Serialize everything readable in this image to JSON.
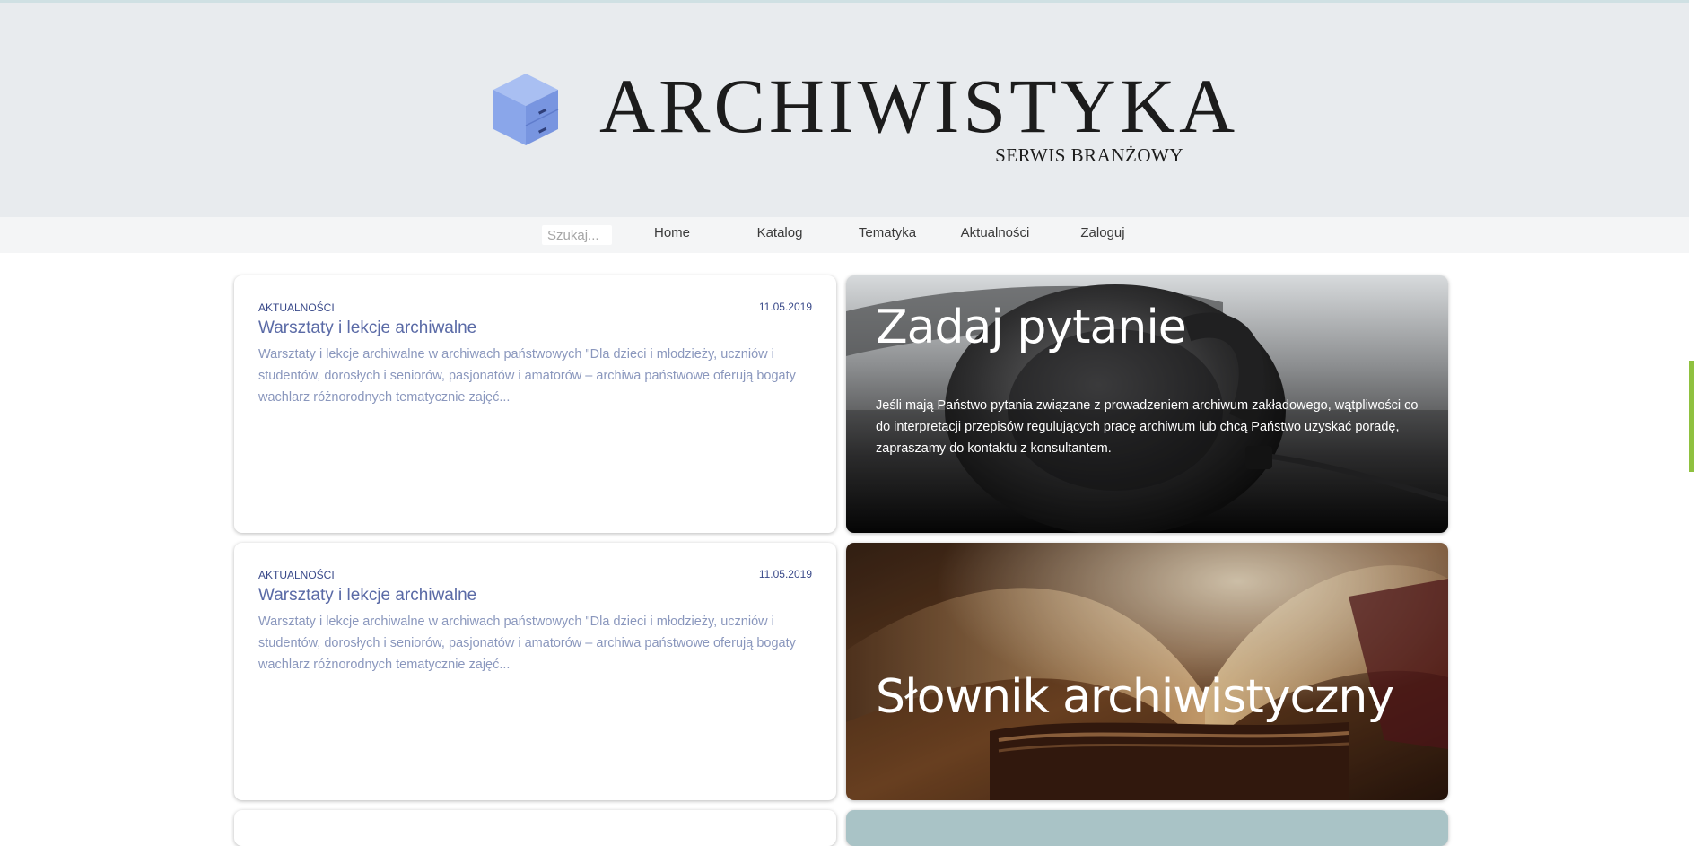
{
  "header": {
    "brand": "ARCHIWISTYKA",
    "tagline": "SERWIS BRANŻOWY",
    "logo_icon": "filing-cabinet-cube-icon"
  },
  "nav": {
    "search_placeholder": "Szukaj...",
    "items": [
      "Home",
      "Katalog",
      "Tematyka",
      "Aktualności",
      "Zaloguj"
    ]
  },
  "articles": [
    {
      "category": "AKTUALNOŚCI",
      "date": "11.05.2019",
      "title": "Warsztaty i lekcje archiwalne",
      "excerpt": "Warsztaty i lekcje archiwalne w archiwach państwowych \"Dla dzieci i młodzieży, uczniów i studentów, dorosłych i seniorów, pasjonatów i amatorów – archiwa państwowe oferują bogaty wachlarz różnorodnych tematycznie zajęć..."
    },
    {
      "category": "AKTUALNOŚCI",
      "date": "11.05.2019",
      "title": "Warsztaty i lekcje archiwalne",
      "excerpt": "Warsztaty i lekcje archiwalne w archiwach państwowych \"Dla dzieci i młodzieży, uczniów i studentów, dorosłych i seniorów, pasjonatów i amatorów – archiwa państwowe oferują bogaty wachlarz różnorodnych tematycznie zajęć..."
    }
  ],
  "features": {
    "ask": {
      "title": "Zadaj pytanie",
      "description": "Jeśli mają Państwo pytania związane z prowadzeniem archiwum zakładowego, wątpliwości co do interpretacji przepisów regulujących pracę archiwum lub chcą Państwo uzyskać poradę, zapraszamy do kontaktu z konsultantem."
    },
    "dictionary": {
      "title": "Słownik archiwistyczny"
    }
  },
  "colors": {
    "header_bg": "#e8ebee",
    "nav_bg": "#f4f5f6",
    "link_blue": "#5a6aa6",
    "scrollbar_accent": "#8fc13f"
  }
}
